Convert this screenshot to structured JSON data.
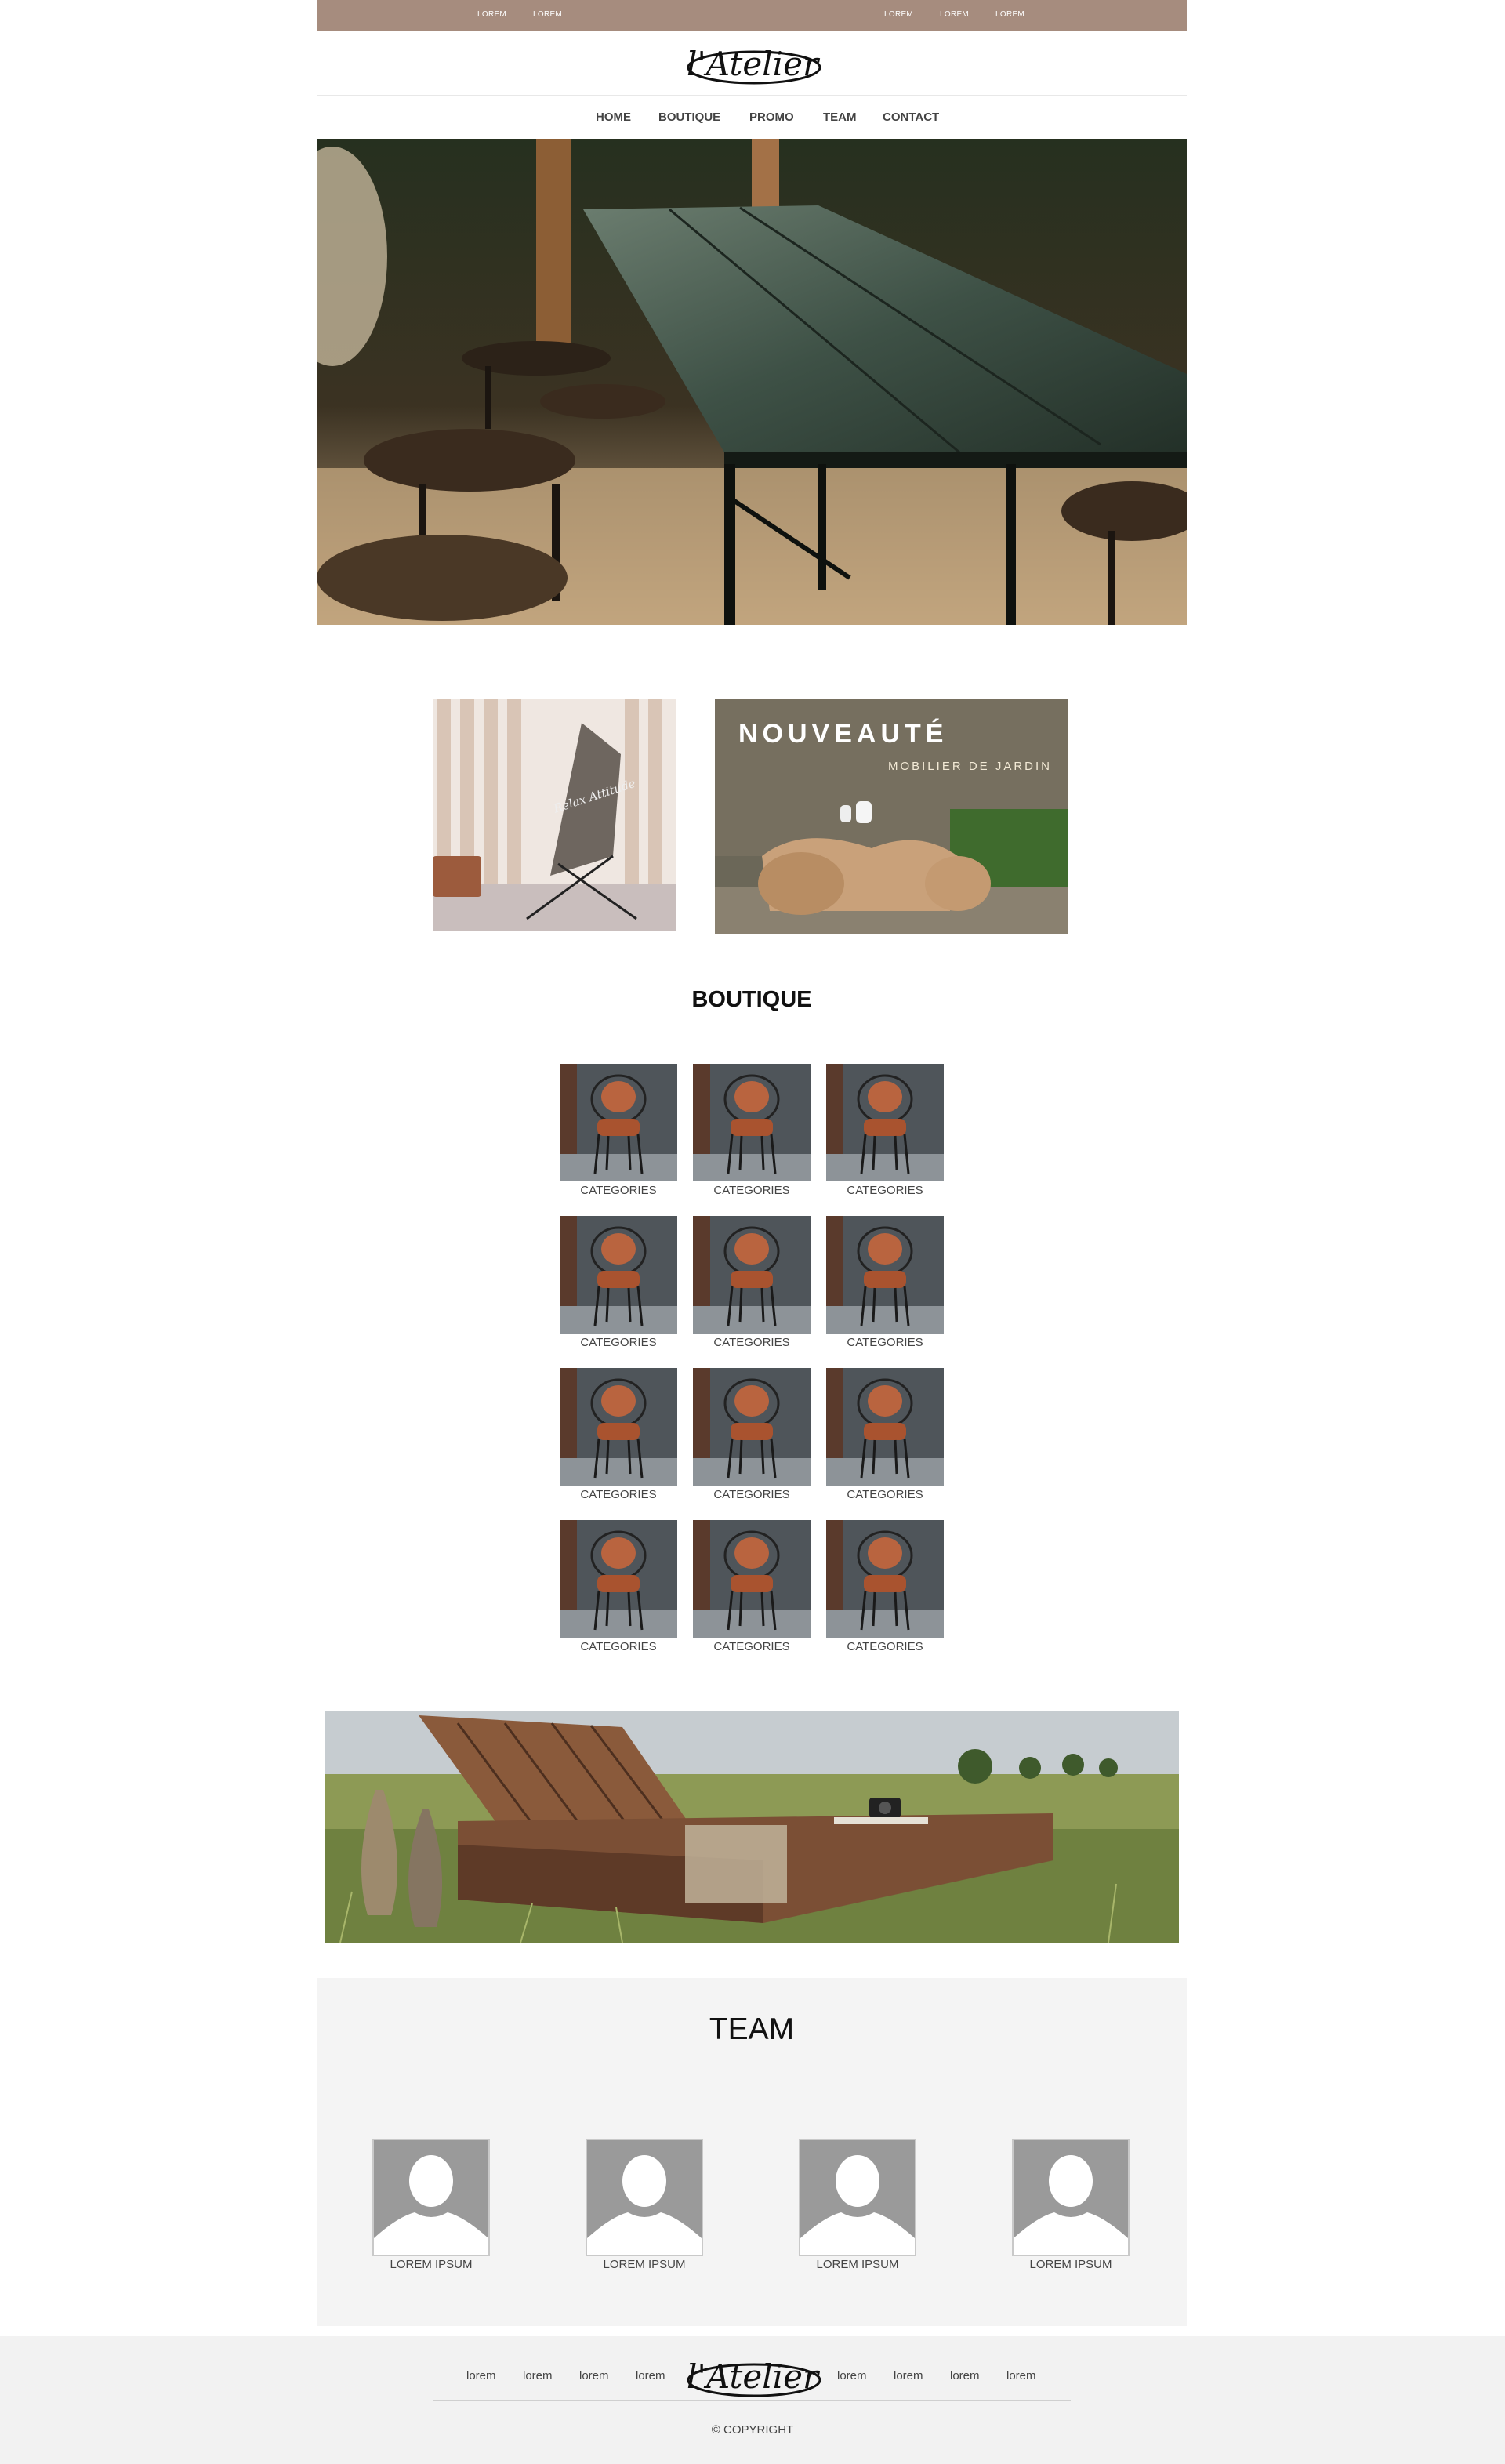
{
  "topbar": {
    "left_links": [
      "LOREM",
      "LOREM"
    ],
    "right_links": [
      "LOREM",
      "LOREM",
      "LOREM"
    ],
    "color": "#a68c7e"
  },
  "brand": {
    "logo_text": "l'Atelier"
  },
  "nav": {
    "items": [
      "HOME",
      "BOUTIQUE",
      "PROMO",
      "TEAM",
      "CONTACT"
    ]
  },
  "promo": {
    "banner_title": "NOUVEAUTÉ",
    "banner_subtitle": "MOBILIER DE JARDIN",
    "chair_print": "Relax Attitude"
  },
  "boutique": {
    "title": "BOUTIQUE",
    "categories": [
      "CATEGORIES",
      "CATEGORIES",
      "CATEGORIES",
      "CATEGORIES",
      "CATEGORIES",
      "CATEGORIES",
      "CATEGORIES",
      "CATEGORIES",
      "CATEGORIES",
      "CATEGORIES",
      "CATEGORIES",
      "CATEGORIES"
    ]
  },
  "team": {
    "title": "TEAM",
    "members": [
      "LOREM IPSUM",
      "LOREM IPSUM",
      "LOREM IPSUM",
      "LOREM IPSUM"
    ]
  },
  "footer": {
    "left_links": [
      "lorem",
      "lorem",
      "lorem",
      "lorem"
    ],
    "right_links": [
      "lorem",
      "lorem",
      "lorem",
      "lorem"
    ],
    "copyright": "© COPYRIGHT"
  }
}
